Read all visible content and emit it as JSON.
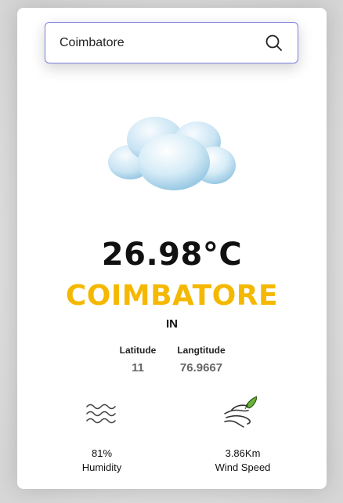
{
  "search": {
    "value": "Coimbatore",
    "placeholder": ""
  },
  "weather": {
    "condition_icon": "cloud-icon",
    "temperature": "26.98°C",
    "city": "COIMBATORE",
    "country": "IN"
  },
  "coordinates": {
    "latitude_label": "Latitude",
    "latitude_value": "11",
    "longitude_label": "Langtitude",
    "longitude_value": "76.9667"
  },
  "stats": {
    "humidity": {
      "icon": "waves-icon",
      "value": "81%",
      "label": "Humidity"
    },
    "wind": {
      "icon": "wind-icon",
      "value": "3.86Km",
      "label": "Wind Speed"
    }
  },
  "colors": {
    "accent_city": "#f5b800",
    "search_border": "#7b7fe0"
  }
}
